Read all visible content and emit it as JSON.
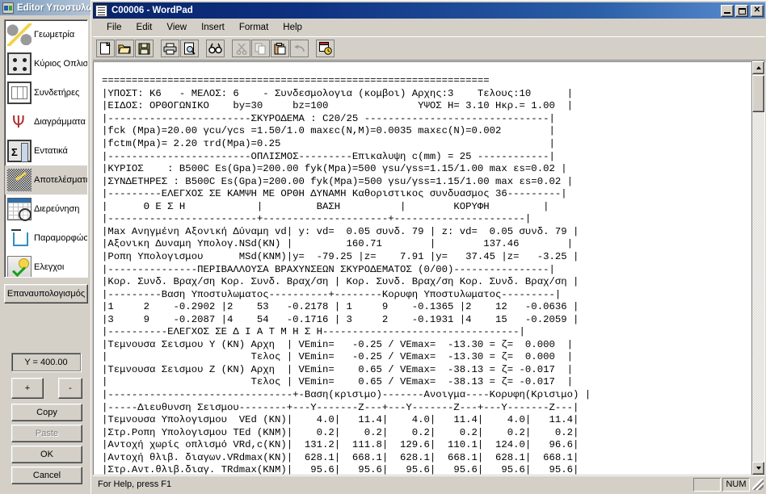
{
  "back_window": {
    "title": "Editor Υποστυλωμάτων",
    "icon": "app-icon",
    "nav_items": [
      {
        "label": "Γεωμετρία",
        "icon": "geometry-icon",
        "selected": false
      },
      {
        "label": "Κύριος Οπλισμός",
        "icon": "main-rebar-icon",
        "selected": false
      },
      {
        "label": "Συνδετήρες",
        "icon": "stirrups-icon",
        "selected": false
      },
      {
        "label": "Διαγράμματα",
        "icon": "diagrams-icon",
        "selected": false
      },
      {
        "label": "Εντατικά",
        "icon": "forces-icon",
        "selected": false
      },
      {
        "label": "Αποτελέσματα",
        "icon": "results-icon",
        "selected": true
      },
      {
        "label": "Διερεύνηση",
        "icon": "investigate-icon",
        "selected": false
      },
      {
        "label": "Παραμορφώσεις",
        "icon": "deformations-icon",
        "selected": false
      },
      {
        "label": "Ελεγχοι",
        "icon": "checks-icon",
        "selected": false
      }
    ],
    "recalc_label": "Επαναυπολογισμός",
    "y_field_value": "Y = 400.00",
    "plus_label": "+",
    "minus_label": "-",
    "copy_label": "Copy",
    "paste_label": "Paste",
    "ok_label": "OK",
    "cancel_label": "Cancel"
  },
  "wordpad": {
    "title": "C00006 - WordPad",
    "doc_icon": "document-icon",
    "caption_buttons": {
      "minimize": "minimize-icon",
      "maximize": "maximize-icon",
      "close": "✕"
    },
    "menu": [
      "File",
      "Edit",
      "View",
      "Insert",
      "Format",
      "Help"
    ],
    "toolbar": [
      {
        "name": "new-icon",
        "enabled": true
      },
      {
        "name": "open-icon",
        "enabled": true
      },
      {
        "name": "save-icon",
        "enabled": true
      },
      {
        "name": "print-icon",
        "enabled": true
      },
      {
        "name": "print-preview-icon",
        "enabled": true
      },
      {
        "name": "find-icon",
        "enabled": true
      },
      {
        "name": "cut-icon",
        "enabled": false
      },
      {
        "name": "copy-icon",
        "enabled": false
      },
      {
        "name": "paste-icon",
        "enabled": true
      },
      {
        "name": "undo-icon",
        "enabled": false
      },
      {
        "name": "date-time-icon",
        "enabled": true
      }
    ],
    "statusbar": {
      "help_text": "For Help, press F1",
      "pane_blank": "",
      "pane_num": "NUM",
      "grip": "resize-grip-icon"
    },
    "scrollbar": {
      "up": "scroll-up-icon",
      "down": "scroll-down-icon",
      "thumb": "scroll-thumb"
    },
    "document_text": "=================================================================\n|ΥΠΟΣΤ: Κ6   - ΜΕΛΟΣ: 6    - Συνδεσμολογια (κομβοι) Αρχης:3    Τελους:10      |\n|ΕΙΔΟΣ: ΟΡΘΟΓΩΝΙΚΟ    by=30     bz=100               ΥΨΟΣ H= 3.10 Hκρ.= 1.00  |\n|------------------------ΣΚΥΡΟΔΕΜΑ : C20/25 -------------------------------|\n|fck (Mpa)=20.00 γcu/γcs =1.50/1.0 maxεc(N,M)=0.0035 maxεc(N)=0.002        |\n|fctm(Mpa)= 2.20 τrd(Mpa)=0.25                                             |\n|------------------------ΟΠΛΙΣΜΟΣ---------Επικαλυψη c(mm) = 25 ------------|\n|ΚΥΡΙΟΣ    : B500C Es(Gpa)=200.00 fyk(Mpa)=500 γsu/γss=1.15/1.00 max εs=0.02 |\n|ΣΥΝΔΕΤΗΡΕΣ : B500C Es(Gpa)=200.00 fyk(Mpa)=500 γsu/γss=1.15/1.00 max εs=0.02 |\n|---------ΕΛΕΓΧΟΣ ΣΕ ΚΑΜΨΗ ΜΕ ΟΡΘΗ ΔΥΝΑΜΗ Καθοριστικος συνδυασμος 36---------|\n|      Θ Ε Σ Η            |         ΒΑΣΗ          |        ΚΟΡΥΦΗ         |\n|-------------------------+---------------------+----------------------|\n|Max Ανηγμένη Αξονική Δύναμη vd| y: vd=  0.05 συνδ. 79 | z: vd=  0.05 συνδ. 79 |\n|Αξονικη Δυναμη Υπολογ.NSd(KN) |         160.71        |        137.46        |\n|Ροπη Υπολογισμου      MSd(KNM)|y=  -79.25 |z=    7.91 |y=   37.45 |z=   -3.25 |\n|---------------ΠΕΡΙΒΑΛΛΟΥΣΑ ΒΡΑΧΥΝΣΕΩΝ ΣΚΥΡΟΔΕΜΑΤΟΣ (0/00)----------------|\n|Κορ. Συνδ. Βραχ/ση Κορ. Συνδ. Βραχ/ση | Κορ. Συνδ. Βραχ/ση Κορ. Συνδ. Βραχ/ση |\n|---------Βαση Υποστυλωματος----------+--------Κορυφη Υποστυλωματος---------|\n|1     2    -0.2902 |2    53   -0.2178 | 1     9    -0.1365 |2    12   -0.0636 |\n|3     9    -0.2087 |4    54   -0.1716 | 3     2    -0.1931 |4    15   -0.2059 |\n|----------ΕΛΕΓΧΟΣ ΣΕ Δ Ι Α Τ Μ Η Σ Η---------------------------------|\n|Τεμνουσα Σεισμου Y (KN) Αρχη  | VEmin=   -0.25 / VEmax=  -13.30 = ζ=  0.000  |\n|                        Τελος | VEmin=   -0.25 / VEmax=  -13.30 = ζ=  0.000  |\n|Τεμνουσα Σεισμου Z (KN) Αρχη  | VEmin=    0.65 / VEmax=  -38.13 = ζ= -0.017  |\n|                        Τελος | VEmin=    0.65 / VEmax=  -38.13 = ζ= -0.017  |\n|-------------------------------+-Βαση(κρισιμο)-------Ανοιγμα----Κορυφη(Κρισιμο) |\n|-----Διευθυνση Σεισμου--------+---Y-------Z---+---Y-------Z---+---Y-------Z---|\n|Τεμνουσα Υπολογισμου  VEd (KN)|    4.0|   11.4|    4.0|   11.4|    4.0|   11.4|\n|Στρ.Ροπη Υπολογισμου ΤEd (KNM)|    0.2|    0.2|    0.2|    0.2|    0.2|    0.2|\n|Αντοχή χωρίς οπλισμό VRd,c(KN)|  131.2|  111.8|  129.6|  110.1|  124.0|   96.6|\n|Αντοχή θλιβ. διαγων.VRdmax(KN)|  628.1|  668.1|  628.1|  668.1|  628.1|  668.1|\n|Στρ.Αντ.θλιβ.διαγ. TRdmax(KNM)|   95.6|   95.6|   95.6|   95.6|   95.6|   95.6|"
  }
}
